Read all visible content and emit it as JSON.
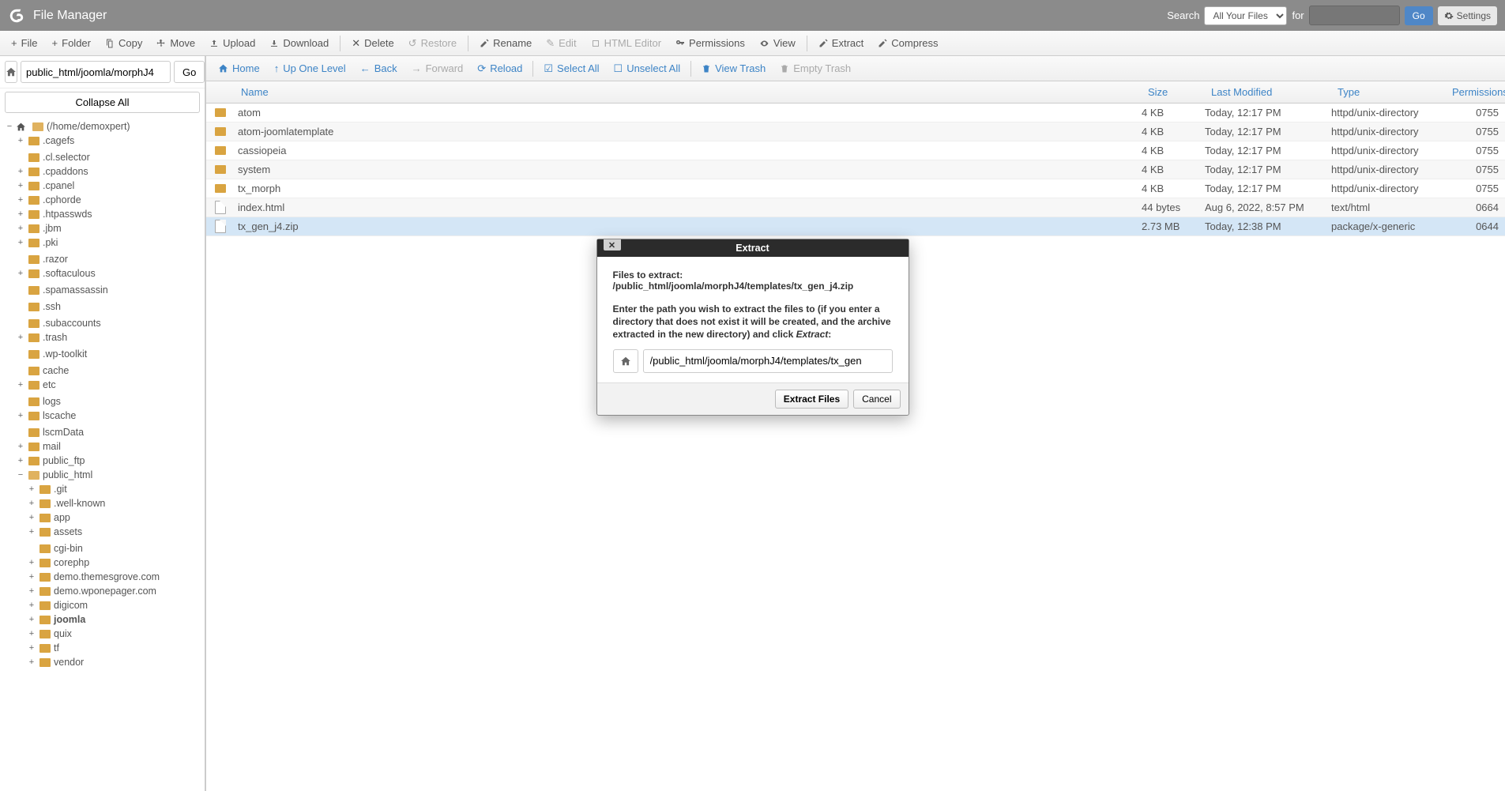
{
  "header": {
    "app_title": "File Manager",
    "search_label": "Search",
    "search_select": "All Your Files",
    "for_label": "for",
    "go_label": "Go",
    "settings_label": "Settings"
  },
  "toolbar": {
    "file": "File",
    "folder": "Folder",
    "copy": "Copy",
    "move": "Move",
    "upload": "Upload",
    "download": "Download",
    "delete": "Delete",
    "restore": "Restore",
    "rename": "Rename",
    "edit": "Edit",
    "html_editor": "HTML Editor",
    "permissions": "Permissions",
    "view": "View",
    "extract": "Extract",
    "compress": "Compress"
  },
  "sidebar": {
    "path_value": "public_html/joomla/morphJ4",
    "go": "Go",
    "collapse": "Collapse All",
    "root": "(/home/demoxpert)",
    "nodes1": [
      {
        "expand": "+",
        "label": ".cagefs"
      },
      {
        "expand": "",
        "label": ".cl.selector"
      },
      {
        "expand": "+",
        "label": ".cpaddons"
      },
      {
        "expand": "+",
        "label": ".cpanel"
      },
      {
        "expand": "+",
        "label": ".cphorde"
      },
      {
        "expand": "+",
        "label": ".htpasswds"
      },
      {
        "expand": "+",
        "label": ".jbm"
      },
      {
        "expand": "+",
        "label": ".pki"
      },
      {
        "expand": "",
        "label": ".razor"
      },
      {
        "expand": "+",
        "label": ".softaculous"
      },
      {
        "expand": "",
        "label": ".spamassassin"
      },
      {
        "expand": "",
        "label": ".ssh"
      },
      {
        "expand": "",
        "label": ".subaccounts"
      },
      {
        "expand": "+",
        "label": ".trash"
      },
      {
        "expand": "",
        "label": ".wp-toolkit"
      },
      {
        "expand": "",
        "label": "cache"
      },
      {
        "expand": "+",
        "label": "etc"
      },
      {
        "expand": "",
        "label": "logs"
      },
      {
        "expand": "+",
        "label": "lscache"
      },
      {
        "expand": "",
        "label": "lscmData"
      },
      {
        "expand": "+",
        "label": "mail"
      },
      {
        "expand": "+",
        "label": "public_ftp"
      }
    ],
    "public_html": "public_html",
    "nodes2": [
      {
        "expand": "+",
        "label": ".git"
      },
      {
        "expand": "+",
        "label": ".well-known"
      },
      {
        "expand": "+",
        "label": "app"
      },
      {
        "expand": "+",
        "label": "assets"
      },
      {
        "expand": "",
        "label": "cgi-bin"
      },
      {
        "expand": "+",
        "label": "corephp"
      },
      {
        "expand": "+",
        "label": "demo.themesgrove.com"
      },
      {
        "expand": "+",
        "label": "demo.wponepager.com"
      },
      {
        "expand": "+",
        "label": "digicom"
      },
      {
        "expand": "+",
        "label": "joomla",
        "bold": true
      },
      {
        "expand": "+",
        "label": "quix"
      },
      {
        "expand": "+",
        "label": "tf"
      },
      {
        "expand": "+",
        "label": "vendor"
      }
    ]
  },
  "actionbar": {
    "home": "Home",
    "up": "Up One Level",
    "back": "Back",
    "forward": "Forward",
    "reload": "Reload",
    "select_all": "Select All",
    "unselect_all": "Unselect All",
    "view_trash": "View Trash",
    "empty_trash": "Empty Trash"
  },
  "table": {
    "cols": {
      "name": "Name",
      "size": "Size",
      "mod": "Last Modified",
      "type": "Type",
      "perm": "Permissions"
    },
    "rows": [
      {
        "icon": "folder",
        "name": "atom",
        "size": "4 KB",
        "mod": "Today, 12:17 PM",
        "type": "httpd/unix-directory",
        "perm": "0755"
      },
      {
        "icon": "folder",
        "name": "atom-joomlatemplate",
        "size": "4 KB",
        "mod": "Today, 12:17 PM",
        "type": "httpd/unix-directory",
        "perm": "0755"
      },
      {
        "icon": "folder",
        "name": "cassiopeia",
        "size": "4 KB",
        "mod": "Today, 12:17 PM",
        "type": "httpd/unix-directory",
        "perm": "0755"
      },
      {
        "icon": "folder",
        "name": "system",
        "size": "4 KB",
        "mod": "Today, 12:17 PM",
        "type": "httpd/unix-directory",
        "perm": "0755"
      },
      {
        "icon": "folder",
        "name": "tx_morph",
        "size": "4 KB",
        "mod": "Today, 12:17 PM",
        "type": "httpd/unix-directory",
        "perm": "0755"
      },
      {
        "icon": "file",
        "name": "index.html",
        "size": "44 bytes",
        "mod": "Aug 6, 2022, 8:57 PM",
        "type": "text/html",
        "perm": "0664"
      },
      {
        "icon": "file",
        "name": "tx_gen_j4.zip",
        "size": "2.73 MB",
        "mod": "Today, 12:38 PM",
        "type": "package/x-generic",
        "perm": "0644",
        "selected": true
      }
    ]
  },
  "modal": {
    "title": "Extract",
    "files_label": "Files to extract:",
    "files_path": "/public_html/joomla/morphJ4/templates/tx_gen_j4.zip",
    "instruction_a": "Enter the path you wish to extract the files to (if you enter a directory that does not exist it will be created, and the archive extracted in the new directory) and click ",
    "instruction_b": "Extract",
    "instruction_c": ":",
    "input_value": "/public_html/joomla/morphJ4/templates/tx_gen",
    "extract_btn": "Extract Files",
    "cancel_btn": "Cancel"
  }
}
